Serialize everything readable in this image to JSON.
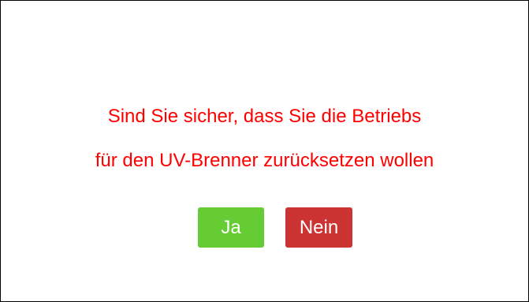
{
  "dialog": {
    "message_line1": "Sind Sie sicher, dass Sie die Betriebs",
    "message_line2": "für den UV-Brenner zurücksetzen wollen",
    "yes_label": "Ja",
    "no_label": "Nein"
  },
  "colors": {
    "message_text": "#ff0000",
    "yes_button": "#66cc33",
    "no_button": "#cc3333",
    "button_text": "#ffffff",
    "border": "#000000",
    "background": "#ffffff"
  }
}
